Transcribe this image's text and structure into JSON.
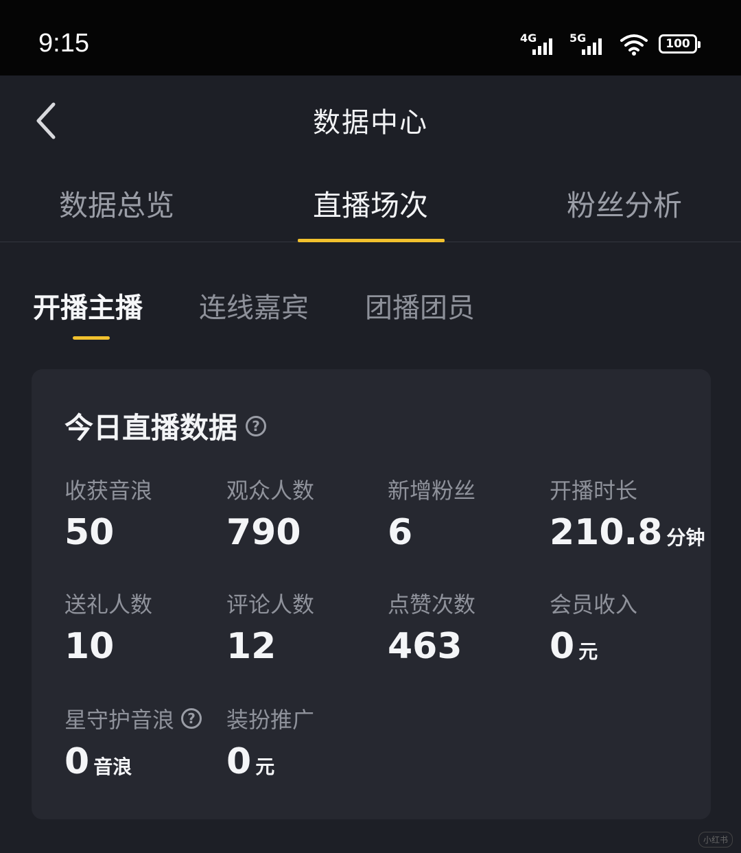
{
  "status_bar": {
    "time": "9:15",
    "net1": "4G",
    "net2": "5G",
    "battery": "100"
  },
  "header": {
    "title": "数据中心"
  },
  "tabs": [
    {
      "label": "数据总览"
    },
    {
      "label": "直播场次"
    },
    {
      "label": "粉丝分析"
    }
  ],
  "subtabs": [
    {
      "label": "开播主播"
    },
    {
      "label": "连线嘉宾"
    },
    {
      "label": "团播团员"
    }
  ],
  "card": {
    "title": "今日直播数据",
    "help_glyph": "?",
    "metrics": [
      {
        "label": "收获音浪",
        "value": "50",
        "unit": ""
      },
      {
        "label": "观众人数",
        "value": "790",
        "unit": ""
      },
      {
        "label": "新增粉丝",
        "value": "6",
        "unit": ""
      },
      {
        "label": "开播时长",
        "value": "210.8",
        "unit": "分钟"
      },
      {
        "label": "送礼人数",
        "value": "10",
        "unit": ""
      },
      {
        "label": "评论人数",
        "value": "12",
        "unit": ""
      },
      {
        "label": "点赞次数",
        "value": "463",
        "unit": ""
      },
      {
        "label": "会员收入",
        "value": "0",
        "unit": "元"
      },
      {
        "label": "星守护音浪",
        "value": "0",
        "unit": "音浪"
      },
      {
        "label": "装扮推广",
        "value": "0",
        "unit": "元"
      }
    ]
  },
  "watermark": "小红书"
}
